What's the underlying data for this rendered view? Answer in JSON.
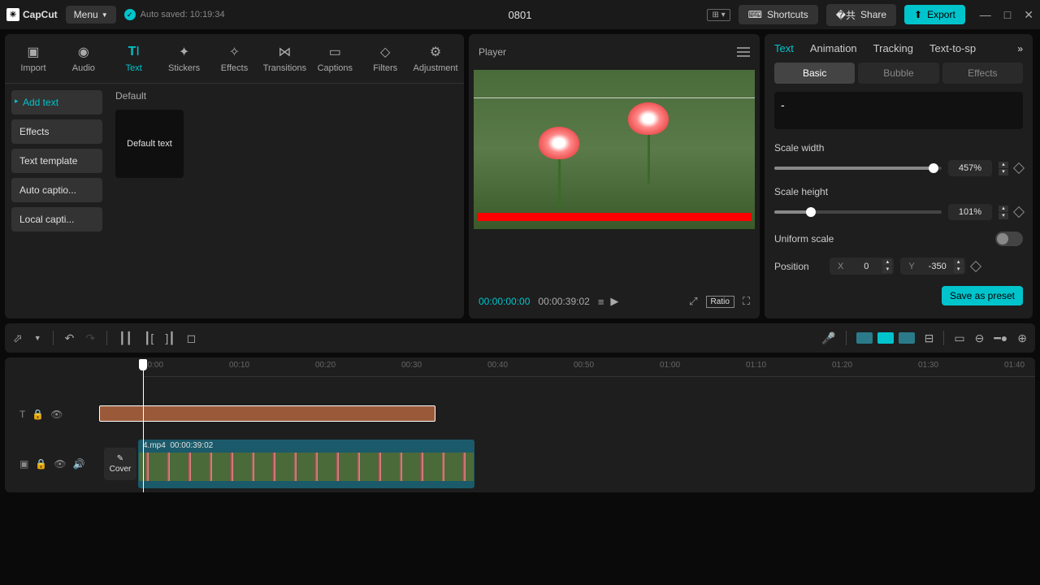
{
  "app": {
    "name": "CapCut",
    "menu": "Menu",
    "autosave": "Auto saved: 10:19:34",
    "project_title": "0801"
  },
  "titlebar": {
    "shortcuts": "Shortcuts",
    "share": "Share",
    "export": "Export"
  },
  "tools": [
    {
      "label": "Import"
    },
    {
      "label": "Audio"
    },
    {
      "label": "Text"
    },
    {
      "label": "Stickers"
    },
    {
      "label": "Effects"
    },
    {
      "label": "Transitions"
    },
    {
      "label": "Captions"
    },
    {
      "label": "Filters"
    },
    {
      "label": "Adjustment"
    }
  ],
  "text_sidebar": [
    "Add text",
    "Effects",
    "Text template",
    "Auto captio...",
    "Local capti..."
  ],
  "text_section": {
    "heading": "Default",
    "card": "Default text"
  },
  "player": {
    "title": "Player",
    "time_current": "00:00:00:00",
    "time_total": "00:00:39:02",
    "ratio": "Ratio"
  },
  "inspector": {
    "tabs": [
      "Text",
      "Animation",
      "Tracking",
      "Text-to-sp"
    ],
    "subtabs": [
      "Basic",
      "Bubble",
      "Effects"
    ],
    "text_value": "-",
    "scale_width_label": "Scale width",
    "scale_width_value": "457%",
    "scale_height_label": "Scale height",
    "scale_height_value": "101%",
    "uniform_label": "Uniform scale",
    "position_label": "Position",
    "pos_x_label": "X",
    "pos_x": "0",
    "pos_y_label": "Y",
    "pos_y": "-350",
    "save_preset": "Save as preset"
  },
  "timeline": {
    "ticks": [
      "00:00",
      "00:10",
      "00:20",
      "00:30",
      "00:40",
      "00:50",
      "01:00",
      "01:10",
      "01:20",
      "01:30",
      "01:40"
    ],
    "cover": "Cover",
    "clip_name": "4.mp4",
    "clip_dur": "00:00:39:02"
  }
}
